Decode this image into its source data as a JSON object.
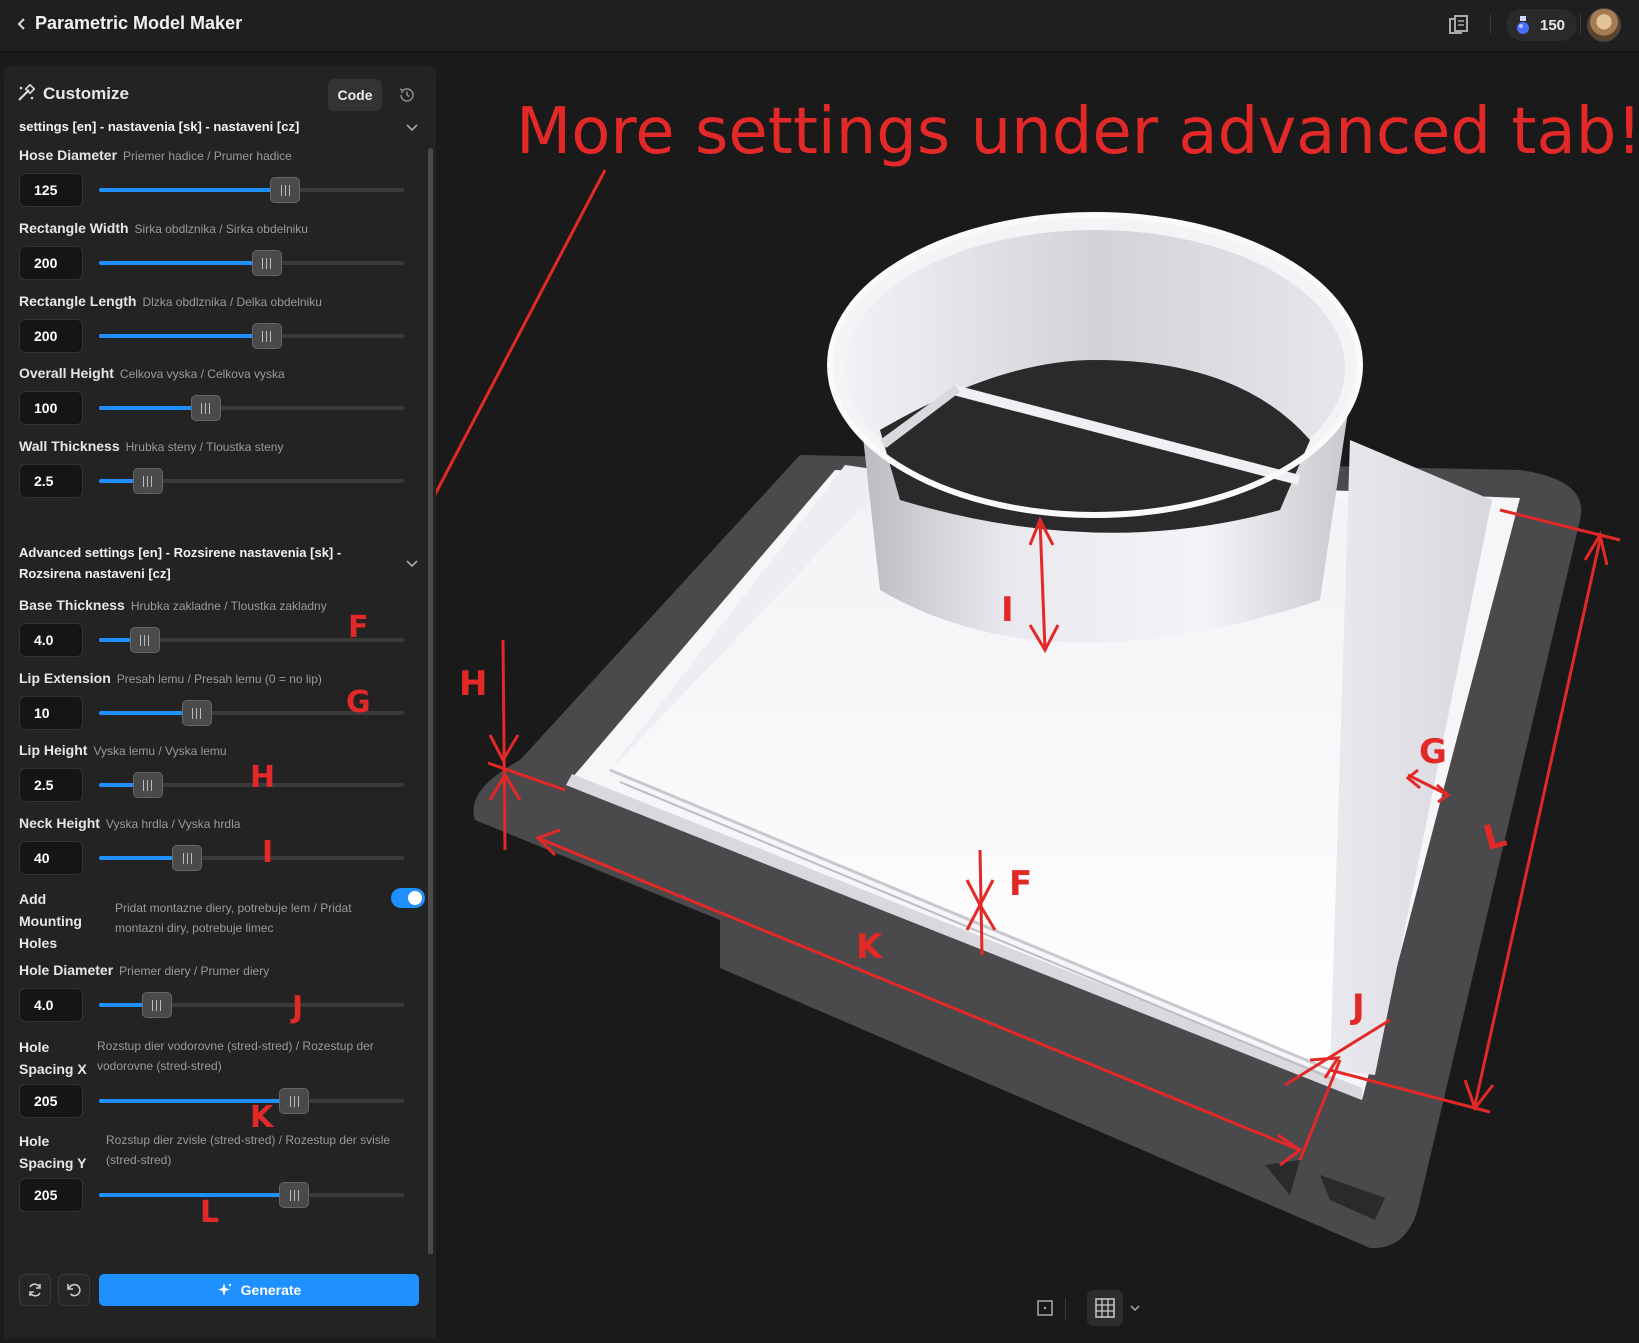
{
  "app": {
    "title": "Parametric Model Maker",
    "credits": "150"
  },
  "panel": {
    "title": "Customize",
    "code_label": "Code",
    "basic_section_title": "settings [en] - nastavenia [sk] - nastaveni [cz]",
    "advanced_section_title_line1": "Advanced settings [en] - Rozsirene nastavenia [sk] -",
    "advanced_section_title_line2": "Rozsirena nastaveni [cz]",
    "params": [
      {
        "label": "Hose Diameter",
        "desc": "Priemer hadice / Prumer hadice",
        "value": "125",
        "level": 0.61
      },
      {
        "label": "Rectangle Width",
        "desc": "Sirka obdlznika / Sirka obdelniku",
        "value": "200",
        "level": 0.55
      },
      {
        "label": "Rectangle Length",
        "desc": "Dlzka obdlznika / Delka obdelniku",
        "value": "200",
        "level": 0.55
      },
      {
        "label": "Overall Height",
        "desc": "Celkova vyska / Celkova vyska",
        "value": "100",
        "level": 0.35
      },
      {
        "label": "Wall Thickness",
        "desc": "Hrubka steny / Tloustka steny",
        "value": "2.5",
        "level": 0.16
      },
      {
        "label": "Base Thickness",
        "desc": "Hrubka zakladne / Tloustka zakladny",
        "value": "4.0",
        "level": 0.15
      },
      {
        "label": "Lip Extension",
        "desc": "Presah lemu / Presah lemu (0 = no lip)",
        "value": "10",
        "level": 0.32
      },
      {
        "label": "Lip Height",
        "desc": "Vyska lemu / Vyska lemu",
        "value": "2.5",
        "level": 0.16
      },
      {
        "label": "Neck Height",
        "desc": "Vyska hrdla / Vyska hrdla",
        "value": "40",
        "level": 0.29
      },
      {
        "label": "Hole Diameter",
        "desc": "Priemer diery / Prumer diery",
        "value": "4.0",
        "level": 0.19
      },
      {
        "label": "Hole Spacing X",
        "desc": "Rozstup dier vodorovne (stred-stred) / Rozestup der vodorovne (stred-stred)",
        "value": "205",
        "level": 0.64
      },
      {
        "label": "Hole Spacing Y",
        "desc": "Rozstup dier zvisle (stred-stred) / Rozestup der svisle (stred-stred)",
        "value": "205",
        "level": 0.64
      }
    ],
    "toggle": {
      "label": "Add Mounting Holes",
      "desc": "Pridat montazne diery, potrebuje lem / Pridat montazni diry, potrebuje limec",
      "checked": true
    },
    "generate_label": "Generate"
  },
  "annotations": {
    "headline": "More settings under advanced tab!",
    "letters": [
      "F",
      "G",
      "H",
      "I",
      "J",
      "K",
      "L"
    ]
  },
  "colors": {
    "accent": "#1e90ff",
    "annotation": "#e32828",
    "background": "#1a1a1a"
  }
}
